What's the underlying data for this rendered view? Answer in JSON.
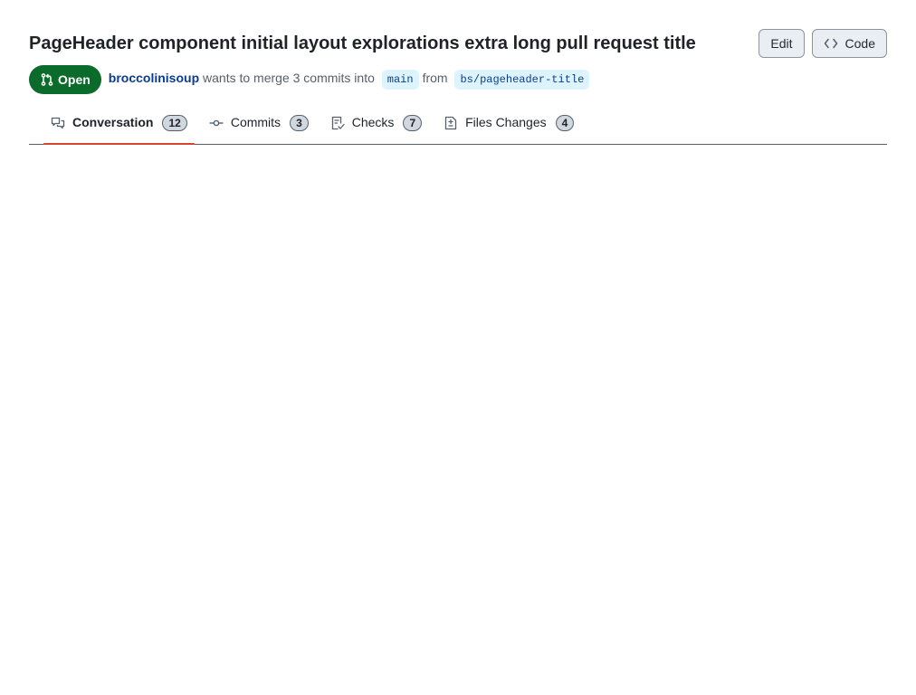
{
  "header": {
    "title": "PageHeader component initial layout explorations extra long pull request title",
    "actions": {
      "edit_label": "Edit",
      "code_label": "Code"
    }
  },
  "meta": {
    "state_label": "Open",
    "author": "broccolinisoup",
    "text_merge": "wants to merge 3 commits into",
    "base_branch": "main",
    "text_from": "from",
    "head_branch": "bs/pageheader-title"
  },
  "tabs": [
    {
      "label": "Conversation",
      "count": "12",
      "selected": true,
      "icon": "comment-discussion-icon"
    },
    {
      "label": "Commits",
      "count": "3",
      "selected": false,
      "icon": "git-commit-icon"
    },
    {
      "label": "Checks",
      "count": "7",
      "selected": false,
      "icon": "checklist-icon"
    },
    {
      "label": "Files Changes",
      "count": "4",
      "selected": false,
      "icon": "file-diff-icon"
    }
  ],
  "colors": {
    "open_badge": "#0a6b2a",
    "link": "#0a3d91",
    "branch_bg": "#ddf4ff",
    "selected_tab_underline": "#d9442f"
  }
}
